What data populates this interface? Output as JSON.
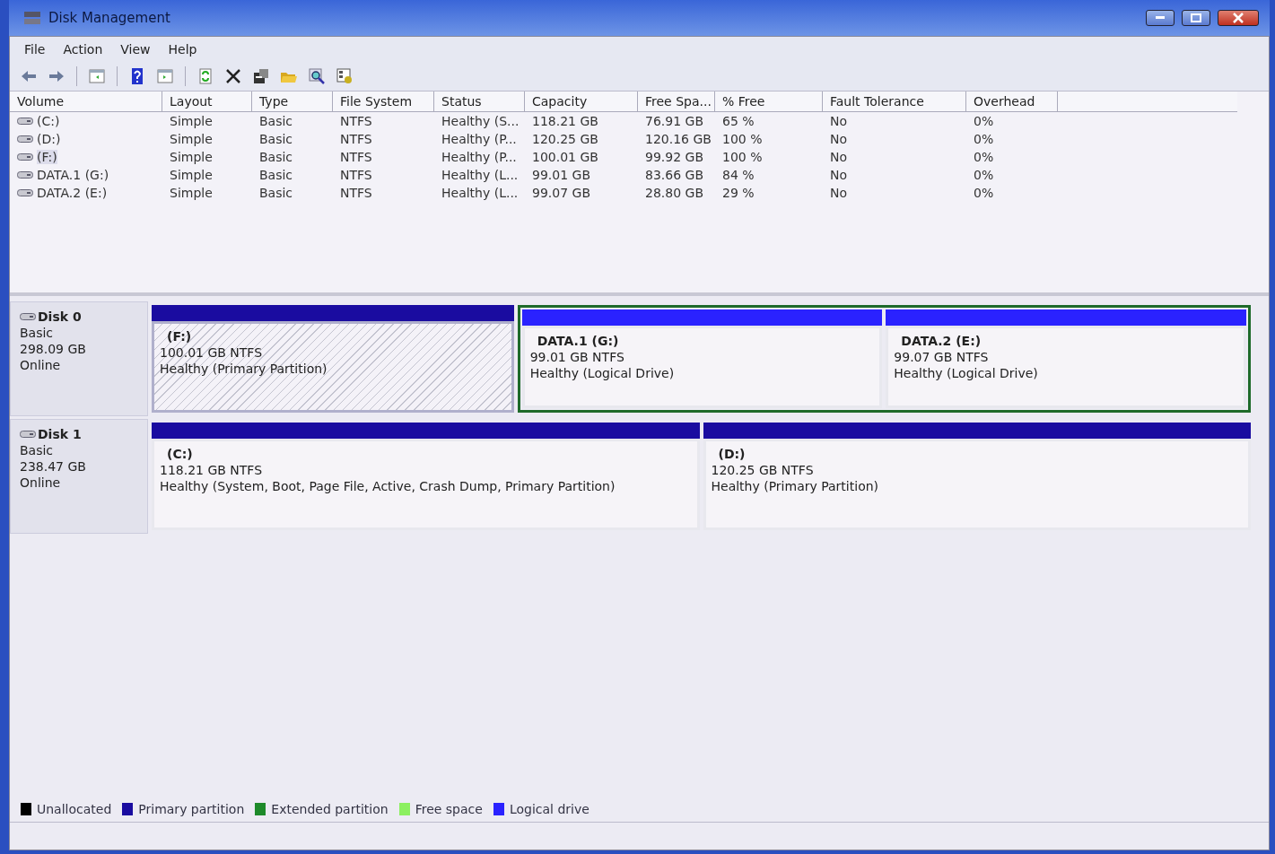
{
  "window": {
    "title": "Disk Management"
  },
  "menu": [
    "File",
    "Action",
    "View",
    "Help"
  ],
  "toolbar": [
    {
      "kind": "back"
    },
    {
      "kind": "forward"
    },
    {
      "kind": "sep"
    },
    {
      "kind": "pane"
    },
    {
      "kind": "sep"
    },
    {
      "kind": "help"
    },
    {
      "kind": "pane2"
    },
    {
      "kind": "sep"
    },
    {
      "kind": "refresh"
    },
    {
      "kind": "delete"
    },
    {
      "kind": "properties"
    },
    {
      "kind": "open"
    },
    {
      "kind": "find"
    },
    {
      "kind": "settings"
    }
  ],
  "table": {
    "columns": [
      "Volume",
      "Layout",
      "Type",
      "File System",
      "Status",
      "Capacity",
      "Free Spa...",
      "% Free",
      "Fault Tolerance",
      "Overhead"
    ],
    "rows": [
      {
        "selected": false,
        "cells": [
          "(C:)",
          "Simple",
          "Basic",
          "NTFS",
          "Healthy (S...",
          "118.21 GB",
          "76.91 GB",
          "65 %",
          "No",
          "0%"
        ]
      },
      {
        "selected": false,
        "cells": [
          "(D:)",
          "Simple",
          "Basic",
          "NTFS",
          "Healthy (P...",
          "120.25 GB",
          "120.16 GB",
          "100 %",
          "No",
          "0%"
        ]
      },
      {
        "selected": true,
        "cells": [
          "(F:)",
          "Simple",
          "Basic",
          "NTFS",
          "Healthy (P...",
          "100.01 GB",
          "99.92 GB",
          "100 %",
          "No",
          "0%"
        ]
      },
      {
        "selected": false,
        "cells": [
          "DATA.1 (G:)",
          "Simple",
          "Basic",
          "NTFS",
          "Healthy (L...",
          "99.01 GB",
          "83.66 GB",
          "84 %",
          "No",
          "0%"
        ]
      },
      {
        "selected": false,
        "cells": [
          "DATA.2 (E:)",
          "Simple",
          "Basic",
          "NTFS",
          "Healthy (L...",
          "99.07 GB",
          "28.80 GB",
          "29 %",
          "No",
          "0%"
        ]
      }
    ]
  },
  "disks": [
    {
      "name": "Disk 0",
      "type": "Basic",
      "size": "298.09 GB",
      "status": "Online",
      "partitions": [
        {
          "kind": "primary",
          "label": "(F:)",
          "size": "100.01 GB NTFS",
          "status": "Healthy (Primary Partition)",
          "selected": true
        },
        {
          "kind": "extended",
          "children": [
            {
              "kind": "logical",
              "label": "DATA.1  (G:)",
              "size": "99.01 GB NTFS",
              "status": "Healthy (Logical Drive)",
              "selected": false
            },
            {
              "kind": "logical",
              "label": "DATA.2  (E:)",
              "size": "99.07 GB NTFS",
              "status": "Healthy (Logical Drive)",
              "selected": false
            }
          ]
        }
      ]
    },
    {
      "name": "Disk 1",
      "type": "Basic",
      "size": "238.47 GB",
      "status": "Online",
      "partitions": [
        {
          "kind": "primary",
          "label": "(C:)",
          "size": "118.21 GB NTFS",
          "status": "Healthy (System, Boot, Page File, Active, Crash Dump, Primary Partition)",
          "selected": false
        },
        {
          "kind": "primary",
          "label": "(D:)",
          "size": "120.25 GB NTFS",
          "status": "Healthy (Primary Partition)",
          "selected": false
        }
      ]
    }
  ],
  "legend": [
    {
      "label": "Unallocated",
      "color": "#000000"
    },
    {
      "label": "Primary partition",
      "color": "#1a0ca0"
    },
    {
      "label": "Extended partition",
      "color": "#1e8a2a"
    },
    {
      "label": "Free space",
      "color": "#8cf060"
    },
    {
      "label": "Logical drive",
      "color": "#2a22ff"
    }
  ]
}
